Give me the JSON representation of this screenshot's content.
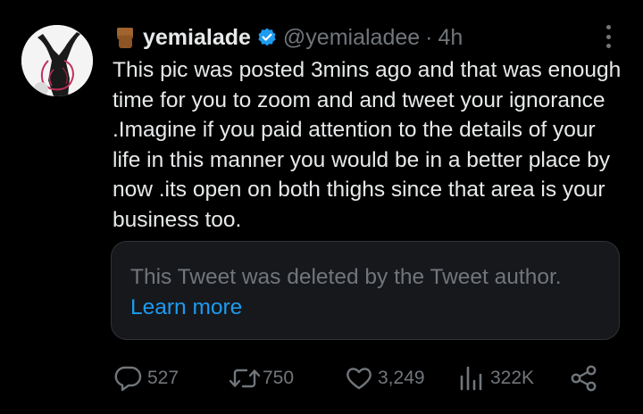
{
  "tweet": {
    "author": {
      "display_name": "yemialade",
      "handle": "@yemialadee",
      "emoji": "raised-fist-emoji",
      "verified": true
    },
    "dot": "·",
    "time": "4h",
    "text": "This pic was posted 3mins ago and that was enough time for you to zoom and and tweet your ignorance .Imagine if you paid attention to the details of your life in this manner you would be in a better place by now .its open on both thighs since that area is your business too.",
    "quoted": {
      "message": "This Tweet was deleted by the Tweet author.",
      "link": "Learn more"
    },
    "stats": {
      "replies": "527",
      "retweets": "750",
      "likes": "3,249",
      "views": "322K"
    }
  },
  "colors": {
    "background": "#000000",
    "text": "#e7e9ea",
    "secondary": "#71767b",
    "link": "#1d9bf0",
    "verified": "#1d9bf0",
    "quote_bg": "#16181c",
    "quote_border": "#2f3336"
  }
}
